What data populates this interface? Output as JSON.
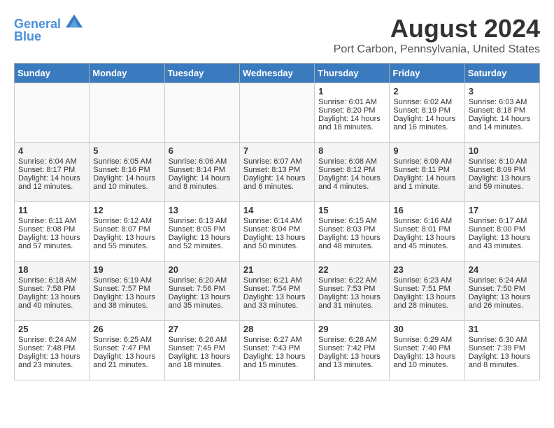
{
  "header": {
    "logo_line1": "General",
    "logo_line2": "Blue",
    "month_year": "August 2024",
    "location": "Port Carbon, Pennsylvania, United States"
  },
  "weekdays": [
    "Sunday",
    "Monday",
    "Tuesday",
    "Wednesday",
    "Thursday",
    "Friday",
    "Saturday"
  ],
  "weeks": [
    [
      {
        "day": "",
        "text": ""
      },
      {
        "day": "",
        "text": ""
      },
      {
        "day": "",
        "text": ""
      },
      {
        "day": "",
        "text": ""
      },
      {
        "day": "1",
        "text": "Sunrise: 6:01 AM\nSunset: 8:20 PM\nDaylight: 14 hours and 18 minutes."
      },
      {
        "day": "2",
        "text": "Sunrise: 6:02 AM\nSunset: 8:19 PM\nDaylight: 14 hours and 16 minutes."
      },
      {
        "day": "3",
        "text": "Sunrise: 6:03 AM\nSunset: 8:18 PM\nDaylight: 14 hours and 14 minutes."
      }
    ],
    [
      {
        "day": "4",
        "text": "Sunrise: 6:04 AM\nSunset: 8:17 PM\nDaylight: 14 hours and 12 minutes."
      },
      {
        "day": "5",
        "text": "Sunrise: 6:05 AM\nSunset: 8:16 PM\nDaylight: 14 hours and 10 minutes."
      },
      {
        "day": "6",
        "text": "Sunrise: 6:06 AM\nSunset: 8:14 PM\nDaylight: 14 hours and 8 minutes."
      },
      {
        "day": "7",
        "text": "Sunrise: 6:07 AM\nSunset: 8:13 PM\nDaylight: 14 hours and 6 minutes."
      },
      {
        "day": "8",
        "text": "Sunrise: 6:08 AM\nSunset: 8:12 PM\nDaylight: 14 hours and 4 minutes."
      },
      {
        "day": "9",
        "text": "Sunrise: 6:09 AM\nSunset: 8:11 PM\nDaylight: 14 hours and 1 minute."
      },
      {
        "day": "10",
        "text": "Sunrise: 6:10 AM\nSunset: 8:09 PM\nDaylight: 13 hours and 59 minutes."
      }
    ],
    [
      {
        "day": "11",
        "text": "Sunrise: 6:11 AM\nSunset: 8:08 PM\nDaylight: 13 hours and 57 minutes."
      },
      {
        "day": "12",
        "text": "Sunrise: 6:12 AM\nSunset: 8:07 PM\nDaylight: 13 hours and 55 minutes."
      },
      {
        "day": "13",
        "text": "Sunrise: 6:13 AM\nSunset: 8:05 PM\nDaylight: 13 hours and 52 minutes."
      },
      {
        "day": "14",
        "text": "Sunrise: 6:14 AM\nSunset: 8:04 PM\nDaylight: 13 hours and 50 minutes."
      },
      {
        "day": "15",
        "text": "Sunrise: 6:15 AM\nSunset: 8:03 PM\nDaylight: 13 hours and 48 minutes."
      },
      {
        "day": "16",
        "text": "Sunrise: 6:16 AM\nSunset: 8:01 PM\nDaylight: 13 hours and 45 minutes."
      },
      {
        "day": "17",
        "text": "Sunrise: 6:17 AM\nSunset: 8:00 PM\nDaylight: 13 hours and 43 minutes."
      }
    ],
    [
      {
        "day": "18",
        "text": "Sunrise: 6:18 AM\nSunset: 7:58 PM\nDaylight: 13 hours and 40 minutes."
      },
      {
        "day": "19",
        "text": "Sunrise: 6:19 AM\nSunset: 7:57 PM\nDaylight: 13 hours and 38 minutes."
      },
      {
        "day": "20",
        "text": "Sunrise: 6:20 AM\nSunset: 7:56 PM\nDaylight: 13 hours and 35 minutes."
      },
      {
        "day": "21",
        "text": "Sunrise: 6:21 AM\nSunset: 7:54 PM\nDaylight: 13 hours and 33 minutes."
      },
      {
        "day": "22",
        "text": "Sunrise: 6:22 AM\nSunset: 7:53 PM\nDaylight: 13 hours and 31 minutes."
      },
      {
        "day": "23",
        "text": "Sunrise: 6:23 AM\nSunset: 7:51 PM\nDaylight: 13 hours and 28 minutes."
      },
      {
        "day": "24",
        "text": "Sunrise: 6:24 AM\nSunset: 7:50 PM\nDaylight: 13 hours and 26 minutes."
      }
    ],
    [
      {
        "day": "25",
        "text": "Sunrise: 6:24 AM\nSunset: 7:48 PM\nDaylight: 13 hours and 23 minutes."
      },
      {
        "day": "26",
        "text": "Sunrise: 6:25 AM\nSunset: 7:47 PM\nDaylight: 13 hours and 21 minutes."
      },
      {
        "day": "27",
        "text": "Sunrise: 6:26 AM\nSunset: 7:45 PM\nDaylight: 13 hours and 18 minutes."
      },
      {
        "day": "28",
        "text": "Sunrise: 6:27 AM\nSunset: 7:43 PM\nDaylight: 13 hours and 15 minutes."
      },
      {
        "day": "29",
        "text": "Sunrise: 6:28 AM\nSunset: 7:42 PM\nDaylight: 13 hours and 13 minutes."
      },
      {
        "day": "30",
        "text": "Sunrise: 6:29 AM\nSunset: 7:40 PM\nDaylight: 13 hours and 10 minutes."
      },
      {
        "day": "31",
        "text": "Sunrise: 6:30 AM\nSunset: 7:39 PM\nDaylight: 13 hours and 8 minutes."
      }
    ]
  ]
}
